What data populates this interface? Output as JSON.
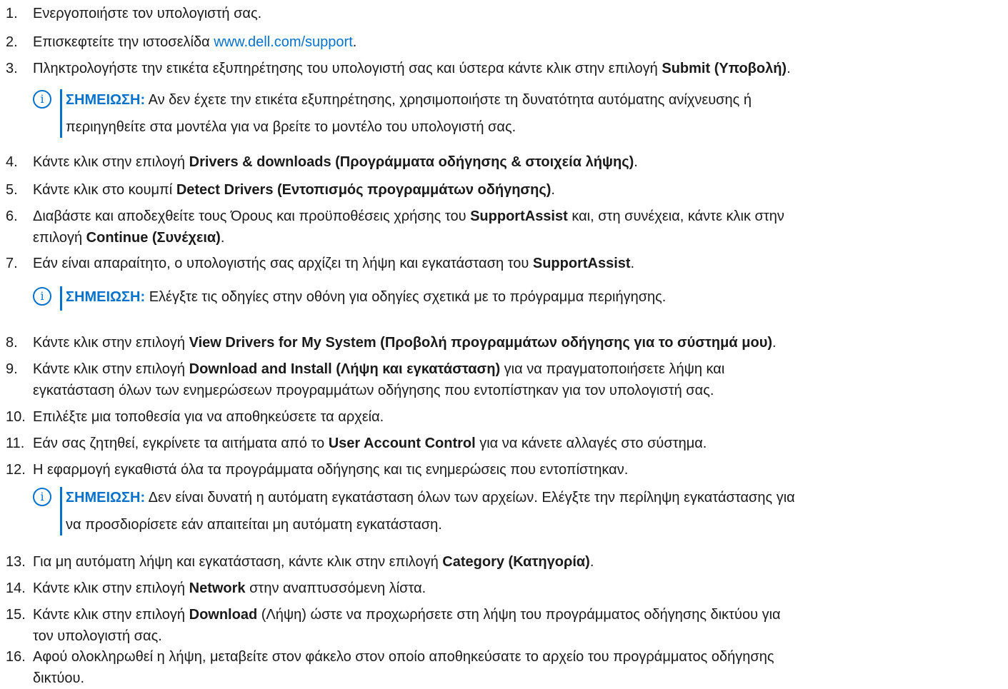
{
  "steps": [
    {
      "n": "1.",
      "parts": [
        "Ενεργοποιήστε τον υπολογιστή σας."
      ]
    },
    {
      "n": "2.",
      "pre": "Επισκεφτείτε την ιστοσελίδα ",
      "link": "www.dell.com/support",
      "post": "."
    },
    {
      "n": "3.",
      "a": "Πληκτρολογήστε την ετικέτα εξυπηρέτησης του υπολογιστή σας και ύστερα κάντε κλικ στην επιλογή ",
      "b": "Submit (Υποβολή)",
      "c": "."
    },
    {
      "n": "4.",
      "a": "Κάντε κλικ στην επιλογή ",
      "b": "Drivers & downloads (Προγράμματα οδήγησης & στοιχεία λήψης)",
      "c": "."
    },
    {
      "n": "5.",
      "a": "Κάντε κλικ στο κουμπί ",
      "b": "Detect Drivers (Εντοπισμός προγραμμάτων οδήγησης)",
      "c": "."
    },
    {
      "n": "6.",
      "a": "Διαβάστε και αποδεχθείτε τους Όρους και προϋποθέσεις χρήσης του ",
      "b": "SupportAssist",
      "c": " και, στη συνέχεια, κάντε κλικ στην",
      "d": "επιλογή ",
      "e": "Continue (Συνέχεια)",
      "f": "."
    },
    {
      "n": "7.",
      "a": "Εάν είναι απαραίτητο, ο υπολογιστής σας αρχίζει τη λήψη και εγκατάσταση του ",
      "b": "SupportAssist",
      "c": "."
    },
    {
      "n": "8.",
      "a": "Κάντε κλικ στην επιλογή ",
      "b": "View Drivers for My System (Προβολή προγραμμάτων οδήγησης για το σύστημά μου)",
      "c": "."
    },
    {
      "n": "9.",
      "a": "Κάντε κλικ στην επιλογή ",
      "b": "Download and Install (Λήψη και εγκατάσταση)",
      "c": " για να πραγματοποιήσετε λήψη και",
      "d": "εγκατάσταση όλων των ενημερώσεων προγραμμάτων οδήγησης που εντοπίστηκαν για τον υπολογιστή σας."
    },
    {
      "n": "10.",
      "a": "Επιλέξτε μια τοποθεσία για να αποθηκεύσετε τα αρχεία."
    },
    {
      "n": "11.",
      "a": "Εάν σας ζητηθεί, εγκρίνετε τα αιτήματα από το ",
      "b": "User Account Control",
      "c": " για να κάνετε αλλαγές στο σύστημα."
    },
    {
      "n": "12.",
      "a": "Η εφαρμογή εγκαθιστά όλα τα προγράμματα οδήγησης και τις ενημερώσεις που εντοπίστηκαν."
    },
    {
      "n": "13.",
      "a": "Για μη αυτόματη λήψη και εγκατάσταση, κάντε κλικ στην επιλογή ",
      "b": "Category (Κατηγορία)",
      "c": "."
    },
    {
      "n": "14.",
      "a": "Κάντε κλικ στην επιλογή ",
      "b": "Network",
      "c": " στην αναπτυσσόμενη λίστα."
    },
    {
      "n": "15.",
      "a": "Κάντε κλικ στην επιλογή ",
      "b": "Download",
      "c": " (Λήψη) ώστε να προχωρήσετε στη λήψη του προγράμματος οδήγησης δικτύου για",
      "d": "τον υπολογιστή σας."
    },
    {
      "n": "16.",
      "a": "Αφού ολοκληρωθεί η λήψη, μεταβείτε στον φάκελο στον οποίο αποθηκεύσατε το αρχείο του προγράμματος οδήγησης",
      "d": "δικτύου."
    }
  ],
  "notes": [
    {
      "label": "ΣΗΜΕΙΩΣΗ:",
      "line1": " Αν δεν έχετε την ετικέτα εξυπηρέτησης, χρησιμοποιήστε τη δυνατότητα αυτόματης ανίχνευσης ή",
      "line2": "περιηγηθείτε στα μοντέλα για να βρείτε το μοντέλο του υπολογιστή σας."
    },
    {
      "label": "ΣΗΜΕΙΩΣΗ:",
      "line1": " Ελέγξτε τις οδηγίες στην οθόνη για οδηγίες σχετικά με το πρόγραμμα περιήγησης."
    },
    {
      "label": "ΣΗΜΕΙΩΣΗ:",
      "line1": " Δεν είναι δυνατή η αυτόματη εγκατάσταση όλων των αρχείων. Ελέγξτε την περίληψη εγκατάστασης για",
      "line2": "να προσδιορίσετε εάν απαιτείται μη αυτόματη εγκατάσταση."
    }
  ],
  "icons": {
    "note": "info-icon",
    "note_glyph": "i"
  },
  "colors": {
    "accent": "#0672cb",
    "text": "#1a1a1a"
  }
}
